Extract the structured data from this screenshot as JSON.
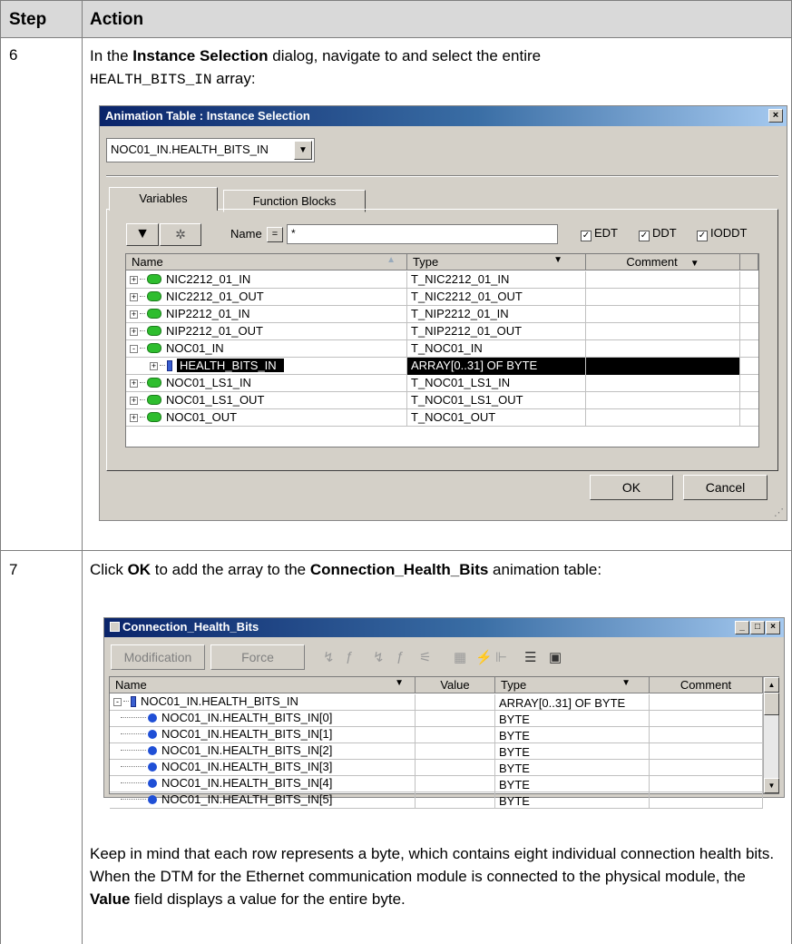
{
  "header": {
    "step": "Step",
    "action": "Action"
  },
  "step6": {
    "number": "6",
    "text_before": "In the ",
    "dialog_name": "Instance Selection",
    "text_mid": " dialog, navigate to and select the entire",
    "array_name": "HEALTH_BITS_IN",
    "text_after": " array:",
    "dialog": {
      "title": "Animation Table : Instance Selection",
      "close_glyph": "×",
      "combo_value": "NOC01_IN.HEALTH_BITS_IN",
      "tabs": [
        "Variables",
        "Function Blocks"
      ],
      "name_label": "Name",
      "name_op": "=",
      "name_filter": "*",
      "checkboxes": [
        "EDT",
        "DDT",
        "IODDT"
      ],
      "columns": [
        "Name",
        "Type",
        "Comment"
      ],
      "rows": [
        {
          "name": "NIC2212_01_IN",
          "type": "T_NIC2212_01_IN",
          "kind": "ddt",
          "expander": "+",
          "indent": 0
        },
        {
          "name": "NIC2212_01_OUT",
          "type": "T_NIC2212_01_OUT",
          "kind": "ddt",
          "expander": "+",
          "indent": 0
        },
        {
          "name": "NIP2212_01_IN",
          "type": "T_NIP2212_01_IN",
          "kind": "ddt",
          "expander": "+",
          "indent": 0
        },
        {
          "name": "NIP2212_01_OUT",
          "type": "T_NIP2212_01_OUT",
          "kind": "ddt",
          "expander": "+",
          "indent": 0
        },
        {
          "name": "NOC01_IN",
          "type": "T_NOC01_IN",
          "kind": "ddt",
          "expander": "-",
          "indent": 0
        },
        {
          "name": "HEALTH_BITS_IN",
          "type": "ARRAY[0..31] OF BYTE",
          "kind": "array",
          "expander": "+",
          "indent": 1,
          "selected": true
        },
        {
          "name": "NOC01_LS1_IN",
          "type": "T_NOC01_LS1_IN",
          "kind": "ddt",
          "expander": "+",
          "indent": 0
        },
        {
          "name": "NOC01_LS1_OUT",
          "type": "T_NOC01_LS1_OUT",
          "kind": "ddt",
          "expander": "+",
          "indent": 0
        },
        {
          "name": "NOC01_OUT",
          "type": "T_NOC01_OUT",
          "kind": "ddt",
          "expander": "+",
          "indent": 0
        }
      ],
      "ok": "OK",
      "cancel": "Cancel"
    }
  },
  "step7": {
    "number": "7",
    "t1": "Click ",
    "ok": "OK",
    "t2": " to add the array to the ",
    "table_name": "Connection_Health_Bits",
    "t3": " animation table:",
    "window": {
      "title": "Connection_Health_Bits",
      "buttons": [
        "Modification",
        "Force"
      ],
      "columns": [
        "Name",
        "Value",
        "Type",
        "Comment"
      ],
      "rows": [
        {
          "name": "NOC01_IN.HEALTH_BITS_IN",
          "type": "ARRAY[0..31] OF BYTE",
          "kind": "array"
        },
        {
          "name": "NOC01_IN.HEALTH_BITS_IN[0]",
          "type": "BYTE",
          "kind": "elem"
        },
        {
          "name": "NOC01_IN.HEALTH_BITS_IN[1]",
          "type": "BYTE",
          "kind": "elem"
        },
        {
          "name": "NOC01_IN.HEALTH_BITS_IN[2]",
          "type": "BYTE",
          "kind": "elem"
        },
        {
          "name": "NOC01_IN.HEALTH_BITS_IN[3]",
          "type": "BYTE",
          "kind": "elem"
        },
        {
          "name": "NOC01_IN.HEALTH_BITS_IN[4]",
          "type": "BYTE",
          "kind": "elem"
        },
        {
          "name": "NOC01_IN.HEALTH_BITS_IN[5]",
          "type": "BYTE",
          "kind": "elem"
        }
      ]
    },
    "note": {
      "a": "Keep in mind that each row represents a byte, which contains eight individual connection health bits. When the DTM for the Ethernet communication module is connected to the physical module, the ",
      "value": "Value",
      "b": " field displays a value for the entire byte."
    }
  }
}
